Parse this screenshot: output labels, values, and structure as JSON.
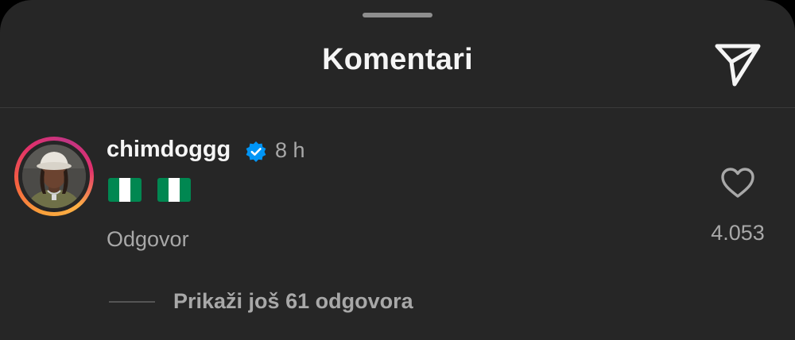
{
  "header": {
    "title": "Komentari",
    "share_icon": "send-icon"
  },
  "comment": {
    "username": "chimdoggg",
    "verified": true,
    "time": "8 h",
    "text_emoji": [
      "nigeria-flag",
      "nigeria-flag"
    ],
    "reply_label": "Odgovor",
    "like_count": "4.053",
    "like_icon": "heart-outline-icon",
    "view_replies_label": "Prikaži još 61 odgovora"
  },
  "colors": {
    "background": "#262626",
    "primary_text": "#f5f5f5",
    "secondary_text": "#a8a8a8",
    "verified_blue": "#0095f6",
    "flag_green": "#008751"
  }
}
